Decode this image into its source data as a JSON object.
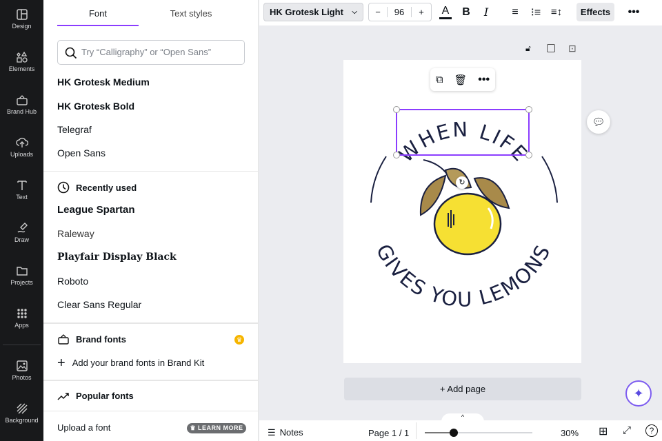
{
  "rail": [
    {
      "label": "Design",
      "icon": "layout-icon"
    },
    {
      "label": "Elements",
      "icon": "shapes-icon"
    },
    {
      "label": "Brand Hub",
      "icon": "brand-icon"
    },
    {
      "label": "Uploads",
      "icon": "cloud-upload-icon"
    },
    {
      "label": "Text",
      "icon": "text-icon"
    },
    {
      "label": "Draw",
      "icon": "draw-icon"
    },
    {
      "label": "Projects",
      "icon": "folder-icon"
    },
    {
      "label": "Apps",
      "icon": "grid-icon"
    },
    {
      "label": "Photos",
      "icon": "image-icon"
    },
    {
      "label": "Background",
      "icon": "hatch-icon"
    }
  ],
  "panel": {
    "tabs": [
      "Font",
      "Text styles"
    ],
    "search_placeholder": "Try “Calligraphy” or “Open Sans”",
    "top_fonts": [
      "HK Grotesk Medium",
      "HK Grotesk Bold",
      "Telegraf",
      "Open Sans"
    ],
    "recent_title": "Recently used",
    "recent_fonts": [
      "League Spartan",
      "Raleway",
      "Playfair Display Black",
      "Roboto",
      "Clear Sans Regular"
    ],
    "brand_title": "Brand fonts",
    "brand_add": "Add your brand fonts in Brand Kit",
    "popular_title": "Popular fonts",
    "upload": "Upload a font",
    "learn_more": "LEARN MORE"
  },
  "toolbar": {
    "font": "HK Grotesk Light",
    "size": "96",
    "minus": "−",
    "plus": "+",
    "effects": "Effects"
  },
  "canvas": {
    "top_text": "WHEN LIFE",
    "bottom_text": "GIVES YOU LEMONS",
    "add_page": "+ Add page"
  },
  "bottom": {
    "notes": "Notes",
    "page": "Page 1 / 1",
    "zoom": "30%",
    "zoom_value": 30
  },
  "colors": {
    "accent": "#8b3dff",
    "rail": "#18191b"
  }
}
